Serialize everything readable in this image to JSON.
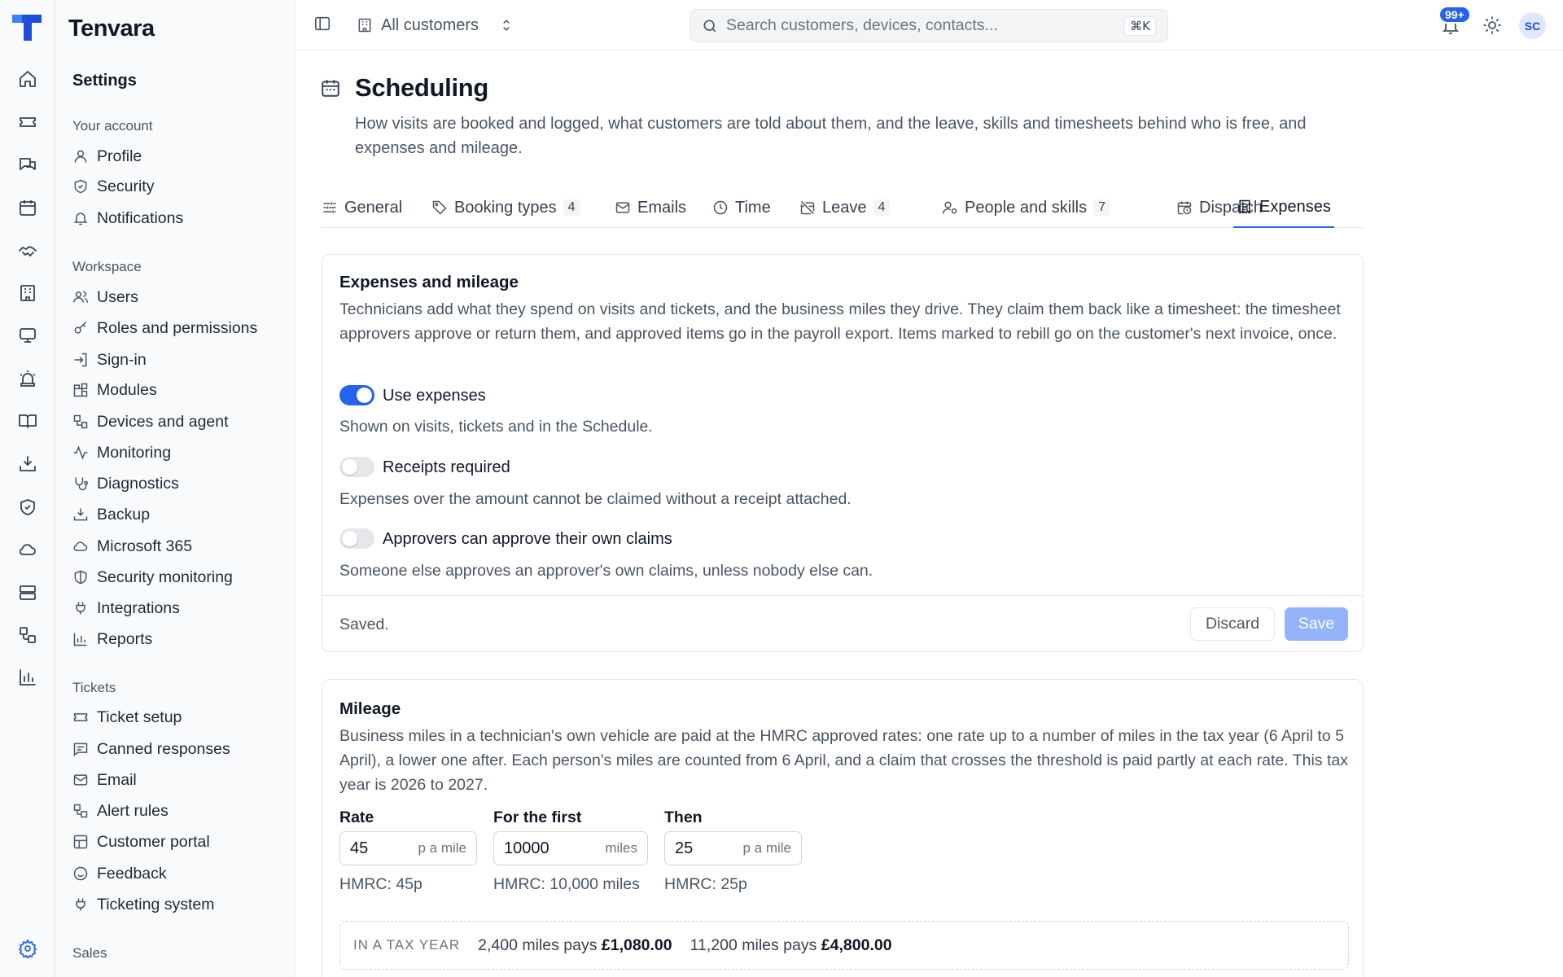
{
  "app": {
    "brand": "Tenvara"
  },
  "sidebar": {
    "title": "Settings",
    "groups": [
      {
        "label": "Your account",
        "items": [
          "Profile",
          "Security",
          "Notifications"
        ]
      },
      {
        "label": "Workspace",
        "items": [
          "Users",
          "Roles and permissions",
          "Sign-in",
          "Modules",
          "Devices and agent",
          "Monitoring",
          "Diagnostics",
          "Backup",
          "Microsoft 365",
          "Security monitoring",
          "Integrations",
          "Reports"
        ]
      },
      {
        "label": "Tickets",
        "items": [
          "Ticket setup",
          "Canned responses",
          "Email",
          "Alert rules",
          "Customer portal",
          "Feedback",
          "Ticketing system"
        ]
      },
      {
        "label": "Sales",
        "items": []
      }
    ]
  },
  "topbar": {
    "customer_selector": "All customers",
    "search_placeholder": "Search customers, devices, contacts...",
    "search_shortcut": "⌘K",
    "notifications_count": "99+",
    "avatar_initials": "SC"
  },
  "page": {
    "title": "Scheduling",
    "description": "How visits are booked and logged, what customers are told about them, and the leave, skills and timesheets behind who is free, and expenses and mileage."
  },
  "tabs": [
    {
      "label": "General",
      "count": null,
      "icon": "sliders-icon"
    },
    {
      "label": "Booking types",
      "count": "4",
      "icon": "tag-icon"
    },
    {
      "label": "Emails",
      "count": null,
      "icon": "mail-icon"
    },
    {
      "label": "Time",
      "count": null,
      "icon": "clock-icon"
    },
    {
      "label": "Leave",
      "count": "4",
      "icon": "calendar-off-icon"
    },
    {
      "label": "People and skills",
      "count": "7",
      "icon": "user-cog-icon"
    },
    {
      "label": "Dispatch",
      "count": null,
      "icon": "calendar-clock-icon"
    },
    {
      "label": "Expenses",
      "count": null,
      "icon": "receipt-icon",
      "active": true
    }
  ],
  "expenses": {
    "title": "Expenses and mileage",
    "description": "Technicians add what they spend on visits and tickets, and the business miles they drive. They claim them back like a timesheet: the timesheet approvers approve or return them, and approved items go in the payroll export. Items marked to rebill go on the customer's next invoice, once.",
    "toggles": [
      {
        "label": "Use expenses",
        "help": "Shown on visits, tickets and in the Schedule.",
        "on": true
      },
      {
        "label": "Receipts required",
        "help": "Expenses over the amount cannot be claimed without a receipt attached.",
        "on": false
      },
      {
        "label": "Approvers can approve their own claims",
        "help": "Someone else approves an approver's own claims, unless nobody else can.",
        "on": false
      }
    ],
    "status": "Saved.",
    "discard_label": "Discard",
    "save_label": "Save"
  },
  "mileage": {
    "title": "Mileage",
    "description": "Business miles in a technician's own vehicle are paid at the HMRC approved rates: one rate up to a number of miles in the tax year (6 April to 5 April), a lower one after. Each person's miles are counted from 6 April, and a claim that crosses the threshold is paid partly at each rate. This tax year is 2026 to 2027.",
    "fields": [
      {
        "label": "Rate",
        "value": "45",
        "unit": "p a mile",
        "help": "HMRC: 45p"
      },
      {
        "label": "For the first",
        "value": "10000",
        "unit": "miles",
        "help": "HMRC: 10,000 miles"
      },
      {
        "label": "Then",
        "value": "25",
        "unit": "p a mile",
        "help": "HMRC: 25p"
      }
    ],
    "summary": {
      "label": "IN A TAX YEAR",
      "examples": [
        {
          "miles": "2,400 miles pays",
          "amount": "£1,080.00"
        },
        {
          "miles": "11,200 miles pays",
          "amount": "£4,800.00"
        }
      ]
    }
  },
  "colors": {
    "accent": "#2563eb",
    "save_disabled": "#93b4f8"
  }
}
